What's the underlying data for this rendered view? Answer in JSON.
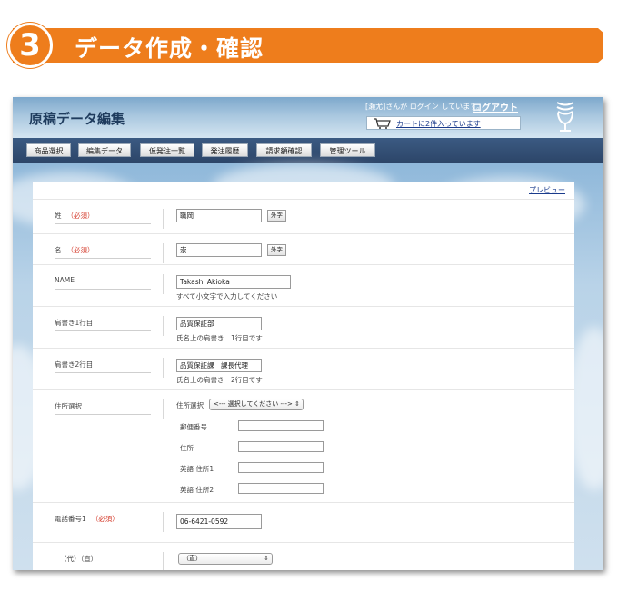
{
  "banner": {
    "step_number": "3",
    "title": "データ作成・確認"
  },
  "header": {
    "title": "原稿データ編集",
    "login_text": "[瀬尤]さんが ログイン しています。",
    "logout_label": "ログアウト",
    "cart_text": "カートに2件入っています"
  },
  "nav": {
    "tabs": [
      {
        "label": "商品選択"
      },
      {
        "label": "編集データ"
      },
      {
        "label": "仮発注一覧"
      },
      {
        "label": "発注履歴"
      },
      {
        "label": "請求額確認"
      },
      {
        "label": "管理ツール"
      }
    ]
  },
  "form": {
    "preview_label": "プレビュー",
    "required_mark": "（必須）",
    "gaiji_label": "外字",
    "last_name": {
      "label": "姓",
      "value": "職岡"
    },
    "first_name": {
      "label": "名",
      "value": "崇"
    },
    "name_roman": {
      "label": "NAME",
      "value": "Takashi Akioka",
      "hint": "すべて小文字で入力してください"
    },
    "title1": {
      "label": "肩書き1行目",
      "value": "品質保証部",
      "hint": "氏名上の肩書き　1行目です"
    },
    "title2": {
      "label": "肩書き2行目",
      "value": "品質保証課　課長代理",
      "hint": "氏名上の肩書き　2行目です"
    },
    "address": {
      "label": "住所選択",
      "select_label": "住所選択",
      "select_value": "<--- 選択してください --->",
      "postal_label": "郵便番号",
      "address_label": "住所",
      "en_address1_label": "英語 住所1",
      "en_address2_label": "英語 住所2"
    },
    "phone1": {
      "label": "電話番号1",
      "value": "06-6421-0592"
    },
    "phone_type": {
      "label": "（代）（直）",
      "select_value": "（直）"
    }
  }
}
